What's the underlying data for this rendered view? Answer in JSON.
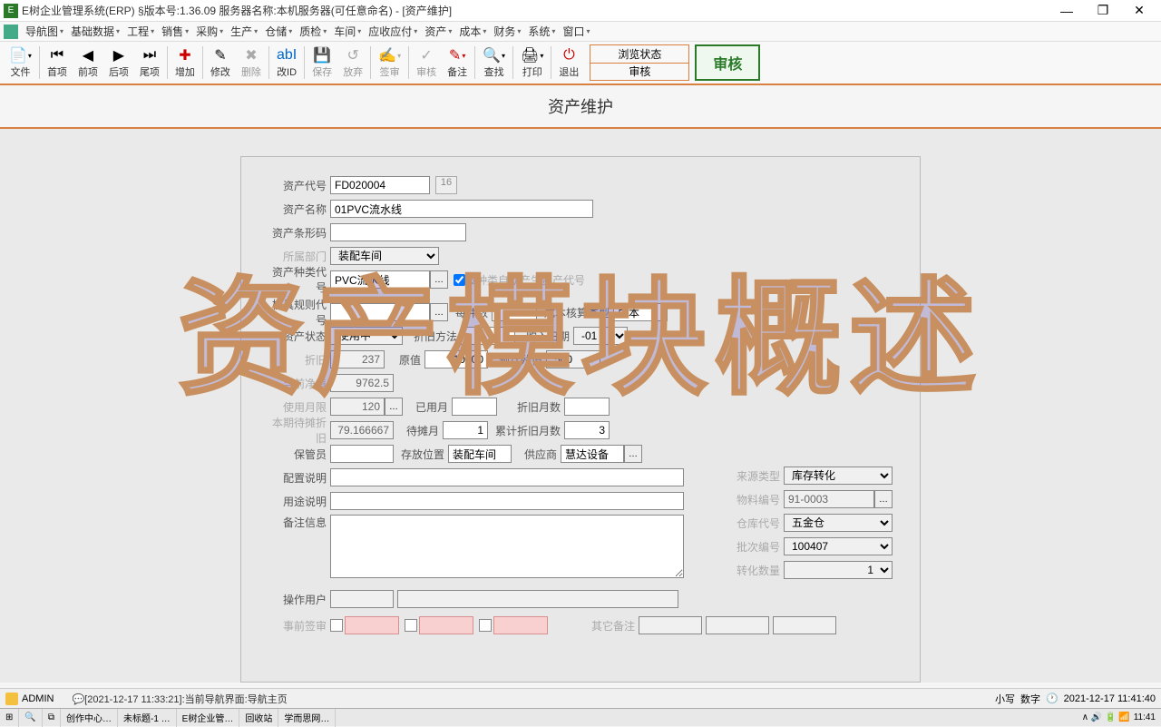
{
  "window": {
    "title": "E树企业管理系统(ERP) §版本号:1.36.09  服务器名称:本机服务器(可任意命名) - [资产维护]",
    "min": "—",
    "max": "❐",
    "close": "✕"
  },
  "menu": {
    "items": [
      "导航图",
      "基础数据",
      "工程",
      "销售",
      "采购",
      "生产",
      "仓储",
      "质检",
      "车间",
      "应收应付",
      "资产",
      "成本",
      "财务",
      "系统",
      "窗口"
    ]
  },
  "toolbar": {
    "file": "文件",
    "first": "首项",
    "prev": "前项",
    "next": "后项",
    "last": "尾项",
    "add": "增加",
    "edit": "修改",
    "del": "删除",
    "chgid": "改ID",
    "save": "保存",
    "abandon": "放弃",
    "sign": "签审",
    "audit": "审核",
    "note": "备注",
    "find": "查找",
    "print": "打印",
    "exit": "退出",
    "status1": "浏览状态",
    "status2": "审核",
    "auditbtn": "审核"
  },
  "page": {
    "title": "资产维护"
  },
  "form": {
    "asset_code_lbl": "资产代号",
    "asset_code": "FD020004",
    "asset_code_seq": "16",
    "asset_name_lbl": "资产名称",
    "asset_name": "01PVC流水线",
    "barcode_lbl": "资产条形码",
    "barcode": "",
    "dept_lbl": "所属部门",
    "dept": "装配车间",
    "type_lbl": "资产种类代号",
    "type": "PVC流水线",
    "type_chk": "按种类自动产生资产代号",
    "mold_lbl": "模具规则代号",
    "unit_lbl": "每件数",
    "cost_type_lbl": "成本核算类型",
    "cost_type": "成本",
    "status_lbl": "资产状态",
    "status": "使用中",
    "depr_lbl": "折旧方法",
    "buy_date_lbl": "购入日期",
    "buy_date": "-01",
    "depr_rate_lbl": "折旧",
    "depr_rate_val": "237",
    "orig_lbl": "原值",
    "orig_val": "10000",
    "resid_lbl": "预计残值",
    "resid_val": "500",
    "net_lbl": "当前净值",
    "net": "9762.5",
    "use_month_lbl": "使用月限",
    "use_month": "120",
    "used_lbl": "已用月",
    "depr_month_lbl": "折旧月数",
    "cur_depr_lbl": "本期待摊折旧",
    "cur_depr": "79.166667",
    "wait_lbl": "待摊月",
    "wait": "1",
    "old_lbl": "累计折旧月数",
    "old": "3",
    "keeper_lbl": "保管员",
    "loc_lbl": "存放位置",
    "loc": "装配车间",
    "supplier_lbl": "供应商",
    "supplier": "慧达设备",
    "config_lbl": "配置说明",
    "usage_lbl": "用途说明",
    "remark_lbl": "备注信息",
    "src_type_lbl": "来源类型",
    "src_type": "库存转化",
    "mat_no_lbl": "物料编号",
    "mat_no": "91-0003",
    "wh_lbl": "仓库代号",
    "wh": "五金仓",
    "batch_lbl": "批次编号",
    "batch": "100407",
    "qty_lbl": "转化数量",
    "qty": "1",
    "op_user_lbl": "操作用户",
    "presign_lbl": "事前签审",
    "other_lbl": "其它备注"
  },
  "watermark": "资产模块概述",
  "status": {
    "user": "ADMIN",
    "msg": "[2021-12-17 11:33:21]:当前导航界面:导航主页",
    "caps": "小写",
    "num": "数字",
    "time": "2021-12-17 11:41:40"
  },
  "taskbar": {
    "items": [
      "创作中心…",
      "未标题-1 …",
      "E树企业管…",
      "回收站",
      "学而思网…"
    ],
    "time": "11:41"
  }
}
